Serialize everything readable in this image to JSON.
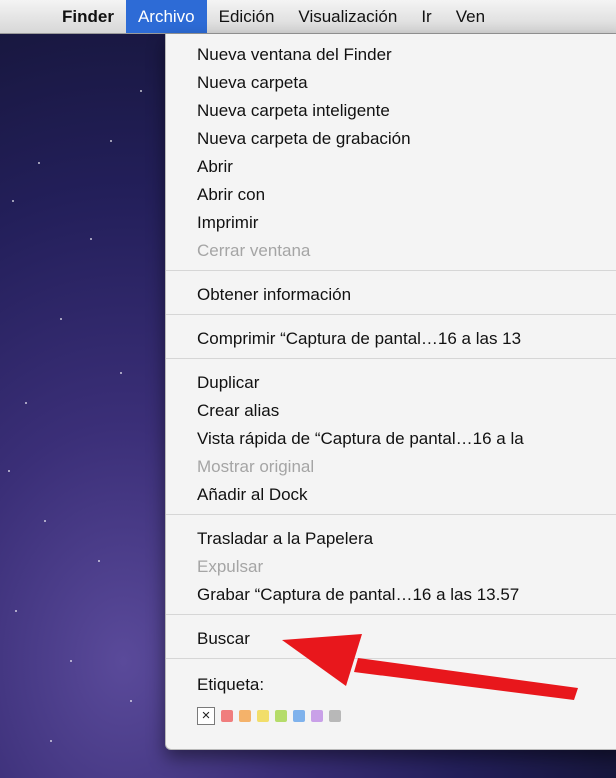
{
  "menubar": {
    "items": [
      {
        "label": "Finder"
      },
      {
        "label": "Archivo"
      },
      {
        "label": "Edición"
      },
      {
        "label": "Visualización"
      },
      {
        "label": "Ir"
      },
      {
        "label": "Ven"
      }
    ]
  },
  "menu": {
    "items": [
      "Nueva ventana del Finder",
      "Nueva carpeta",
      "Nueva carpeta inteligente",
      "Nueva carpeta de grabación",
      "Abrir",
      "Abrir con",
      "Imprimir",
      "Cerrar ventana",
      "Obtener información",
      "Comprimir “Captura de pantal…16 a las 13",
      "Duplicar",
      "Crear alias",
      "Vista rápida de “Captura de pantal…16 a la",
      "Mostrar original",
      "Añadir al Dock",
      "Trasladar a la Papelera",
      "Expulsar",
      "Grabar “Captura de pantal…16 a las 13.57",
      "Buscar",
      "Etiqueta:"
    ],
    "label_none": "×",
    "label_colors": [
      "#f07d7d",
      "#f4b26a",
      "#f2de6a",
      "#b5dc6a",
      "#7fb2ec",
      "#c9a0e8",
      "#b8b8b8"
    ]
  },
  "annotation": {
    "arrow_color": "#e8171c",
    "target": "Buscar"
  }
}
